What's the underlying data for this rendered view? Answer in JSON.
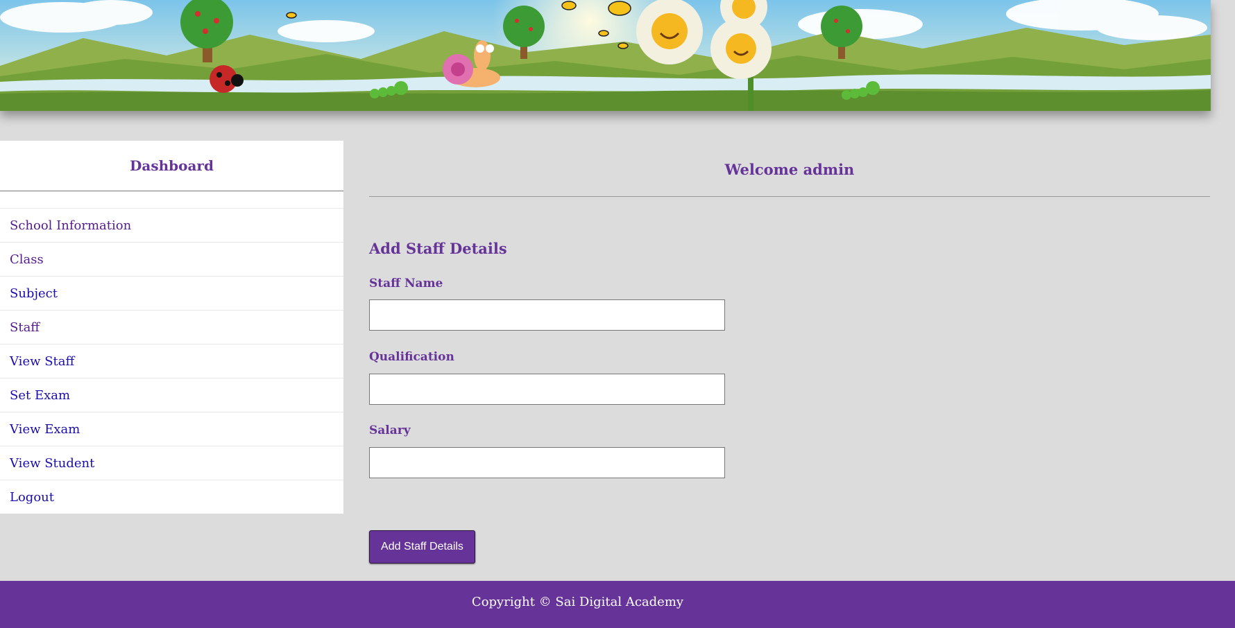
{
  "sidebar": {
    "title": "Dashboard",
    "items": [
      {
        "label": "School Information"
      },
      {
        "label": "Class"
      },
      {
        "label": "Subject"
      },
      {
        "label": "Staff"
      },
      {
        "label": "View Staff"
      },
      {
        "label": "Set Exam"
      },
      {
        "label": "View Exam"
      },
      {
        "label": "View Student"
      },
      {
        "label": "Logout"
      }
    ]
  },
  "main": {
    "welcome": "Welcome admin",
    "form_title": "Add Staff Details",
    "fields": [
      {
        "label": "Staff Name",
        "value": ""
      },
      {
        "label": "Qualification",
        "value": ""
      },
      {
        "label": "Salary",
        "value": ""
      }
    ],
    "submit_label": "Add Staff Details"
  },
  "footer": {
    "text": "Copyright © Sai Digital Academy"
  },
  "colors": {
    "accent": "#663399",
    "background": "#dcdcdc",
    "link": "#1a0dab",
    "visited_link": "#551a8b"
  }
}
